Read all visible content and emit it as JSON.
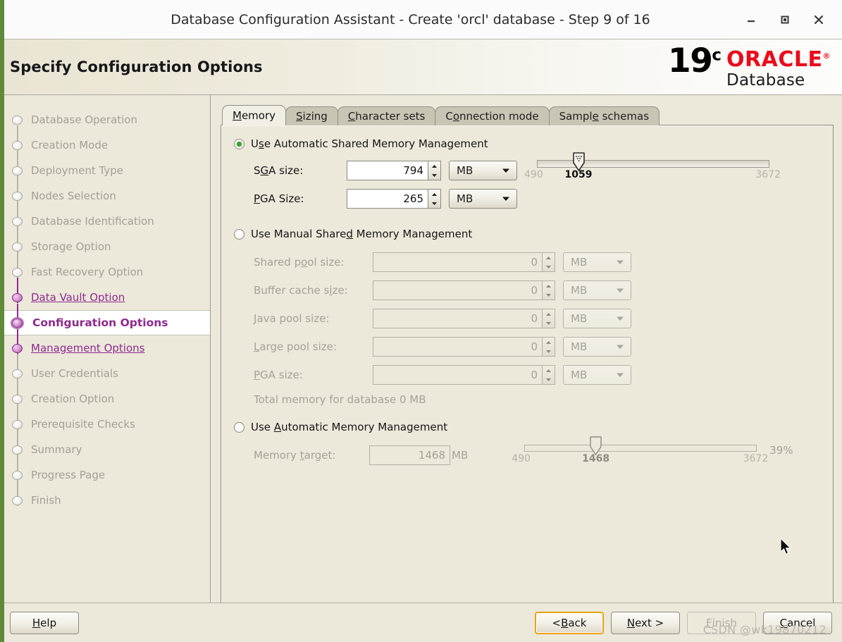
{
  "window": {
    "title": "Database Configuration Assistant - Create 'orcl' database - Step 9 of 16",
    "minimize_icon": "minimize-icon",
    "maximize_icon": "maximize-icon",
    "close_icon": "close-icon"
  },
  "header": {
    "page_title": "Specify Configuration Options",
    "logo_version": "19",
    "logo_version_sup": "c",
    "logo_brand": "ORACLE",
    "logo_product": "Database",
    "brand_color": "#ea0b1b"
  },
  "sidebar": {
    "items": [
      {
        "label": "Database Operation",
        "state": "pending"
      },
      {
        "label": "Creation Mode",
        "state": "pending"
      },
      {
        "label": "Deployment Type",
        "state": "pending"
      },
      {
        "label": "Nodes Selection",
        "state": "pending"
      },
      {
        "label": "Database Identification",
        "state": "pending"
      },
      {
        "label": "Storage Option",
        "state": "pending"
      },
      {
        "label": "Fast Recovery Option",
        "state": "pending"
      },
      {
        "label": "Data Vault Option",
        "state": "reached"
      },
      {
        "label": "Configuration Options",
        "state": "active"
      },
      {
        "label": "Management Options",
        "state": "reached"
      },
      {
        "label": "User Credentials",
        "state": "pending"
      },
      {
        "label": "Creation Option",
        "state": "pending"
      },
      {
        "label": "Prerequisite Checks",
        "state": "pending"
      },
      {
        "label": "Summary",
        "state": "pending"
      },
      {
        "label": "Progress Page",
        "state": "pending"
      },
      {
        "label": "Finish",
        "state": "pending"
      }
    ]
  },
  "tabs": [
    {
      "label": "Memory",
      "mnemonic": "M",
      "selected": true
    },
    {
      "label": "Sizing",
      "mnemonic": "S",
      "selected": false
    },
    {
      "label": "Character sets",
      "mnemonic": "C",
      "selected": false
    },
    {
      "label": "Connection mode",
      "mnemonic": "o",
      "selected": false
    },
    {
      "label": "Sample schemas",
      "mnemonic": "e",
      "selected": false
    }
  ],
  "memory": {
    "automatic_shared": {
      "label_pre": "U",
      "label_mn": "s",
      "label_post": "e Automatic Shared Memory Management",
      "selected": true,
      "sga": {
        "label_pre": "S",
        "label_mn": "G",
        "label_post": "A size:",
        "value": "794",
        "unit": "MB"
      },
      "pga": {
        "label_pre": "",
        "label_mn": "P",
        "label_post": "GA Size:",
        "value": "265",
        "unit": "MB"
      },
      "slider": {
        "min": "490",
        "max": "3672",
        "current": "1059",
        "min_num": 490,
        "max_num": 3672,
        "current_num": 1059
      }
    },
    "manual_shared": {
      "label_pre": "Use Manual Share",
      "label_mn": "d",
      "label_post": " Memory Management",
      "selected": false,
      "fields": [
        {
          "label_pre": "Shared p",
          "label_mn": "o",
          "label_post": "ol size:",
          "value": "0",
          "unit": "MB"
        },
        {
          "label_pre": "Buffer cache s",
          "label_mn": "i",
          "label_post": "ze:",
          "value": "0",
          "unit": "MB"
        },
        {
          "label_pre": "",
          "label_mn": "J",
          "label_post": "ava pool size:",
          "value": "0",
          "unit": "MB"
        },
        {
          "label_pre": "",
          "label_mn": "L",
          "label_post": "arge pool size:",
          "value": "0",
          "unit": "MB"
        },
        {
          "label_pre": "",
          "label_mn": "P",
          "label_post": "GA size:",
          "value": "0",
          "unit": "MB"
        }
      ],
      "total_memory": "Total memory for database 0 MB"
    },
    "automatic_memory": {
      "label_pre": "Use ",
      "label_mn": "A",
      "label_post": "utomatic Memory Management",
      "selected": false,
      "target": {
        "label_pre": "Memory ",
        "label_mn": "t",
        "label_post": "arget:",
        "value": "1468",
        "unit": "MB"
      },
      "slider": {
        "min": "490",
        "max": "3672",
        "current": "1468",
        "min_num": 490,
        "max_num": 3672,
        "current_num": 1468
      },
      "percent": "39%"
    }
  },
  "footer": {
    "help": {
      "pre": "",
      "mn": "H",
      "post": "elp"
    },
    "back": {
      "pre": "< ",
      "mn": "B",
      "post": "ack"
    },
    "next": {
      "pre": "",
      "mn": "N",
      "post": "ext >"
    },
    "finish": {
      "pre": "",
      "mn": "F",
      "post": "inish"
    },
    "cancel": {
      "pre": "",
      "mn": "C",
      "post": "ancel"
    },
    "watermark": "CSDN @wk19870212"
  }
}
